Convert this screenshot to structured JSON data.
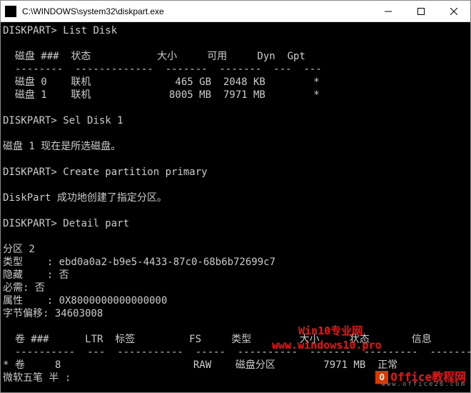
{
  "window": {
    "title": "C:\\WINDOWS\\system32\\diskpart.exe"
  },
  "console": {
    "prompt": "DISKPART>",
    "cmd_list_disk": "List Disk",
    "header_disk": "  磁盘 ###  状态           大小     可用     Dyn  Gpt",
    "divider_disk": "  --------  -------------  -------  -------  ---  ---",
    "disk_rows": [
      "  磁盘 0    联机              465 GB  2048 KB        *",
      "  磁盘 1    联机             8005 MB  7971 MB        *"
    ],
    "cmd_sel_disk": "Sel Disk 1",
    "msg_sel_disk": "磁盘 1 现在是所选磁盘。",
    "cmd_create_part": "Create partition primary",
    "msg_create_part": "DiskPart 成功地创建了指定分区。",
    "cmd_detail_part": "Detail part",
    "part_info": [
      "分区 2",
      "类型    : ebd0a0a2-b9e5-4433-87c0-68b6b72699c7",
      "隐藏    : 否",
      "必需: 否",
      "属性    : 0X8000000000000000",
      "字节偏移: 34603008"
    ],
    "header_vol": "  卷 ###      LTR  标签         FS     类型        大小     状态       信息",
    "divider_vol": "  ----------  ---  -----------  -----  ----------  -------  ---------  --------",
    "vol_rows": [
      "* 卷     8                      RAW    磁盘分区        7971 MB  正常"
    ],
    "ime_status": "微软五笔 半 :"
  },
  "watermarks": {
    "brand1_line1": "Win10专业网",
    "brand1_line2": "www.windows10.pro",
    "brand2_text": "Office教程网",
    "brand2_sub": "www.office26.com"
  }
}
